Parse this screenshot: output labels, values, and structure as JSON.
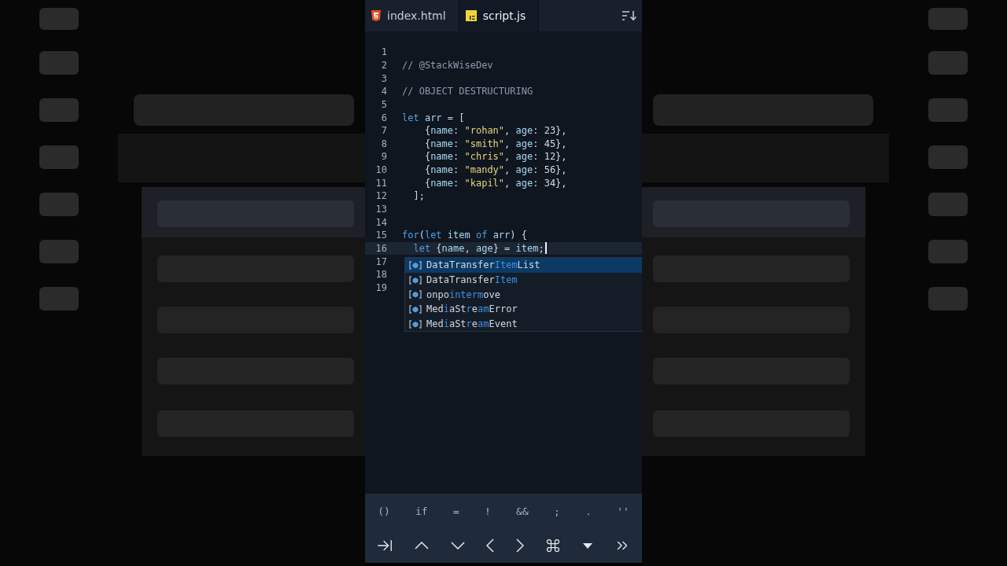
{
  "tabs": [
    {
      "label": "index.html",
      "kind": "html",
      "selected": false
    },
    {
      "label": "script.js",
      "kind": "js",
      "selected": true
    }
  ],
  "code": [
    {
      "n": "1"
    },
    {
      "n": "2",
      "tokens": [
        {
          "kind": "comment",
          "text": "// @StackWiseDev"
        }
      ]
    },
    {
      "n": "3"
    },
    {
      "n": "4",
      "tokens": [
        {
          "kind": "comment",
          "text": "// OBJECT DESTRUCTURING"
        }
      ]
    },
    {
      "n": "5"
    },
    {
      "n": "6",
      "tokens": [
        {
          "kind": "keyword",
          "text": "let"
        },
        {
          "kind": "variable",
          "text": " arr"
        },
        {
          "kind": "plain",
          "text": " = ["
        }
      ]
    },
    {
      "n": "7",
      "tokens": [
        {
          "kind": "plain",
          "text": "    {"
        },
        {
          "kind": "variable",
          "text": "name"
        },
        {
          "kind": "plain",
          "text": ": "
        },
        {
          "kind": "string",
          "text": "\"rohan\""
        },
        {
          "kind": "plain",
          "text": ", "
        },
        {
          "kind": "variable",
          "text": "age"
        },
        {
          "kind": "plain",
          "text": ": 23},"
        }
      ]
    },
    {
      "n": "8",
      "tokens": [
        {
          "kind": "plain",
          "text": "    {"
        },
        {
          "kind": "variable",
          "text": "name"
        },
        {
          "kind": "plain",
          "text": ": "
        },
        {
          "kind": "string",
          "text": "\"smith\""
        },
        {
          "kind": "plain",
          "text": ", "
        },
        {
          "kind": "variable",
          "text": "age"
        },
        {
          "kind": "plain",
          "text": ": 45},"
        }
      ]
    },
    {
      "n": "9",
      "tokens": [
        {
          "kind": "plain",
          "text": "    {"
        },
        {
          "kind": "variable",
          "text": "name"
        },
        {
          "kind": "plain",
          "text": ": "
        },
        {
          "kind": "string",
          "text": "\"chris\""
        },
        {
          "kind": "plain",
          "text": ", "
        },
        {
          "kind": "variable",
          "text": "age"
        },
        {
          "kind": "plain",
          "text": ": 12},"
        }
      ]
    },
    {
      "n": "10",
      "tokens": [
        {
          "kind": "plain",
          "text": "    {"
        },
        {
          "kind": "variable",
          "text": "name"
        },
        {
          "kind": "plain",
          "text": ": "
        },
        {
          "kind": "string",
          "text": "\"mandy\""
        },
        {
          "kind": "plain",
          "text": ", "
        },
        {
          "kind": "variable",
          "text": "age"
        },
        {
          "kind": "plain",
          "text": ": 56},"
        }
      ]
    },
    {
      "n": "11",
      "tokens": [
        {
          "kind": "plain",
          "text": "    {"
        },
        {
          "kind": "variable",
          "text": "name"
        },
        {
          "kind": "plain",
          "text": ": "
        },
        {
          "kind": "string",
          "text": "\"kapil\""
        },
        {
          "kind": "plain",
          "text": ", "
        },
        {
          "kind": "variable",
          "text": "age"
        },
        {
          "kind": "plain",
          "text": ": 34},"
        }
      ]
    },
    {
      "n": "12",
      "tokens": [
        {
          "kind": "plain",
          "text": "  ];"
        }
      ]
    },
    {
      "n": "13"
    },
    {
      "n": "14"
    },
    {
      "n": "15",
      "tokens": [
        {
          "kind": "keyword",
          "text": "for"
        },
        {
          "kind": "plain",
          "text": "("
        },
        {
          "kind": "keyword",
          "text": "let"
        },
        {
          "kind": "variable",
          "text": " item"
        },
        {
          "kind": "keyword",
          "text": " of"
        },
        {
          "kind": "variable",
          "text": " arr"
        },
        {
          "kind": "plain",
          "text": ") {"
        }
      ]
    },
    {
      "n": "16",
      "current": true,
      "cursor": true,
      "tokens": [
        {
          "kind": "keyword",
          "text": "  let"
        },
        {
          "kind": "plain",
          "text": " {"
        },
        {
          "kind": "variable",
          "text": "name"
        },
        {
          "kind": "plain",
          "text": ", "
        },
        {
          "kind": "variable",
          "text": "age"
        },
        {
          "kind": "plain",
          "text": "} = "
        },
        {
          "kind": "variable",
          "text": "item"
        },
        {
          "kind": "plain",
          "text": ";"
        }
      ]
    },
    {
      "n": "17"
    },
    {
      "n": "18"
    },
    {
      "n": "19"
    }
  ],
  "suggestions": [
    {
      "selected": true,
      "parts": [
        {
          "text": "DataTransfer",
          "match": false
        },
        {
          "text": "Item",
          "match": true
        },
        {
          "text": "List",
          "match": false
        }
      ]
    },
    {
      "selected": false,
      "parts": [
        {
          "text": "DataTransfer",
          "match": false
        },
        {
          "text": "Item",
          "match": true
        }
      ]
    },
    {
      "selected": false,
      "parts": [
        {
          "text": "onpo",
          "match": false
        },
        {
          "text": "inter",
          "match": true
        },
        {
          "text": "m",
          "match": true
        },
        {
          "text": "ove",
          "match": false
        }
      ]
    },
    {
      "selected": false,
      "parts": [
        {
          "text": "Med",
          "match": false
        },
        {
          "text": "i",
          "match": true
        },
        {
          "text": "aSt",
          "match": false
        },
        {
          "text": "r",
          "match": true
        },
        {
          "text": "e",
          "match": false
        },
        {
          "text": "am",
          "match": true
        },
        {
          "text": "Error",
          "match": false
        }
      ]
    },
    {
      "selected": false,
      "parts": [
        {
          "text": "Med",
          "match": false
        },
        {
          "text": "i",
          "match": true
        },
        {
          "text": "aSt",
          "match": false
        },
        {
          "text": "r",
          "match": true
        },
        {
          "text": "e",
          "match": false
        },
        {
          "text": "am",
          "match": true
        },
        {
          "text": "Event",
          "match": false
        }
      ]
    }
  ],
  "symbol_keys": [
    "()",
    "if",
    "=",
    "!",
    "&&",
    ";",
    ".",
    "''"
  ]
}
